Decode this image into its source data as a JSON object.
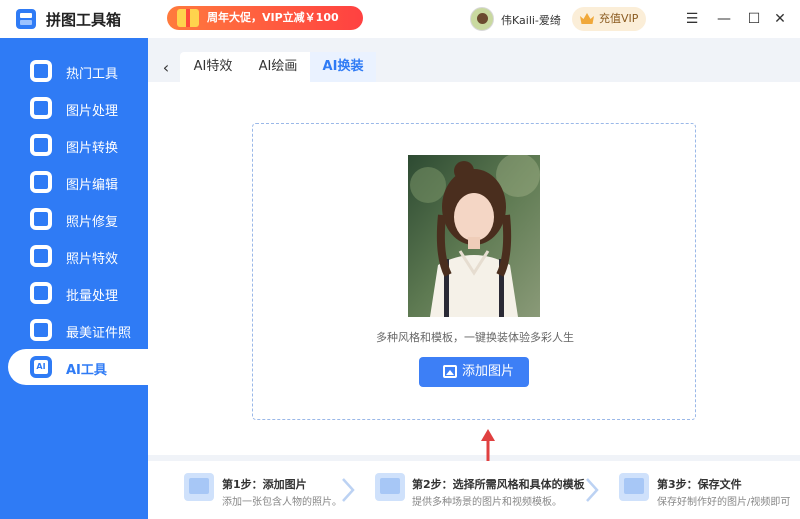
{
  "app": {
    "title": "拼图工具箱"
  },
  "promo": {
    "text": "周年大促，VIP立减￥100"
  },
  "user": {
    "name": "伟Kaili-爱绮"
  },
  "vip_button": {
    "label": "充值VIP"
  },
  "window_controls": {
    "menu": "☰",
    "minimize": "—",
    "maximize": "☐",
    "close": "✕"
  },
  "sidebar": {
    "items": [
      {
        "label": "热门工具",
        "icon": "hot-tools-icon"
      },
      {
        "label": "图片处理",
        "icon": "image-process-icon"
      },
      {
        "label": "图片转换",
        "icon": "image-convert-icon"
      },
      {
        "label": "图片编辑",
        "icon": "image-edit-icon"
      },
      {
        "label": "照片修复",
        "icon": "photo-repair-icon"
      },
      {
        "label": "照片特效",
        "icon": "photo-effects-icon"
      },
      {
        "label": "批量处理",
        "icon": "batch-process-icon"
      },
      {
        "label": "最美证件照",
        "icon": "id-photo-icon"
      },
      {
        "label": "AI工具",
        "icon": "ai-tools-icon",
        "badge": "AI"
      }
    ]
  },
  "tabs": [
    {
      "label": "AI特效"
    },
    {
      "label": "AI绘画"
    },
    {
      "label": "AI换装"
    }
  ],
  "upload": {
    "caption": "多种风格和模板，一键换装体验多彩人生",
    "button_label": "添加图片"
  },
  "steps": [
    {
      "title": "第1步：添加图片",
      "desc": "添加一张包含人物的照片。"
    },
    {
      "title": "第2步：选择所需风格和具体的模板",
      "desc": "提供多种场景的图片和视频模板。"
    },
    {
      "title": "第3步：保存文件",
      "desc": "保存好制作好的图片/视频即可"
    }
  ],
  "colors": {
    "accent": "#2f7bf5",
    "sidebar_bg": "#2f7bf5",
    "promo": "#ff4141",
    "vip_bg": "#fbeed8",
    "arrow": "#e04040"
  }
}
